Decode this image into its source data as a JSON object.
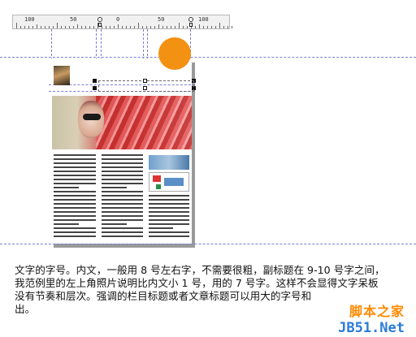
{
  "ruler": {
    "labels": [
      "100",
      "50",
      "0",
      "50",
      "100"
    ]
  },
  "caption": {
    "lines": [
      "文字的字号。内文，一般用 8 号左右字，不需要很粗，副标题在 9-10 号字之间，",
      "我范例里的左上角照片说明比内文小 1 号，用的 7 号字。这样不会显得文字呆板",
      "没有节奏和层次。强调的栏目标题或者文章标题可以用大的字号和",
      "出。"
    ]
  },
  "watermark": {
    "cn": "脚本之家",
    "en": "JB51.Net"
  },
  "colors": {
    "accent": "#f39112",
    "guide": "#7d7ddc",
    "watermark_cn": "#ff8a00",
    "watermark_en": "#2b7bd6"
  }
}
